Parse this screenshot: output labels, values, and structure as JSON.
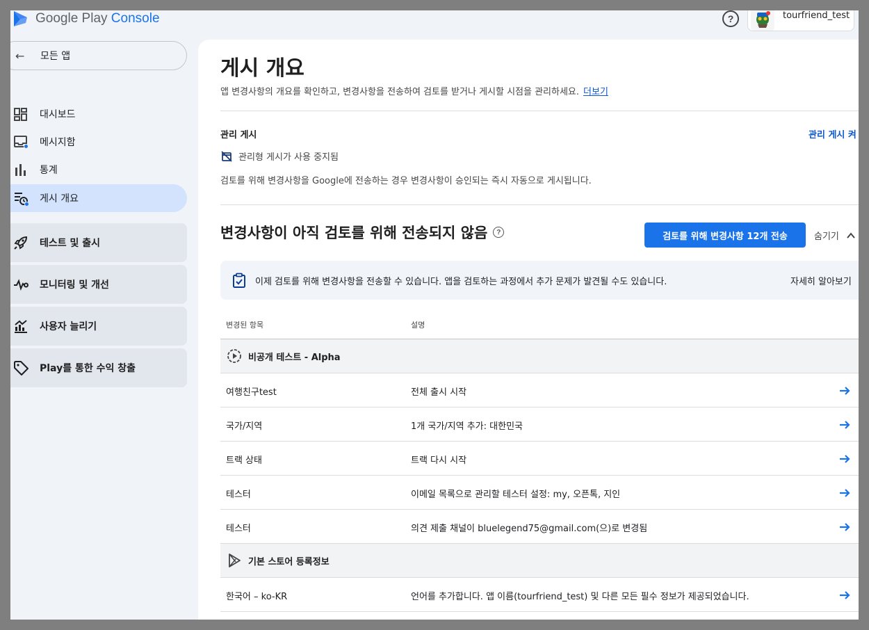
{
  "header": {
    "logo_text_main": "Google Play",
    "logo_text_accent": "Console",
    "account_name": "tourfriend_test"
  },
  "sidebar": {
    "back_label": "모든 앱",
    "items": [
      {
        "label": "대시보드",
        "icon": "dashboard-icon"
      },
      {
        "label": "메시지함",
        "icon": "inbox-icon"
      },
      {
        "label": "통계",
        "icon": "bar-chart-icon"
      },
      {
        "label": "게시 개요",
        "icon": "publishing-overview-icon"
      }
    ],
    "sections": [
      {
        "label": "테스트 및 출시",
        "icon": "rocket-icon"
      },
      {
        "label": "모니터링 및 개선",
        "icon": "vitals-icon"
      },
      {
        "label": "사용자 늘리기",
        "icon": "growth-icon"
      },
      {
        "label": "Play를 통한 수익 창출",
        "icon": "tag-icon"
      }
    ]
  },
  "page": {
    "title": "게시 개요",
    "description": "앱 변경사항의 개요를 확인하고, 변경사항을 전송하여 검토를 받거나 게시할 시점을 관리하세요.",
    "learn_more": "더보기"
  },
  "managed_publishing": {
    "title": "관리 게시",
    "toggle_link": "관리 게시 켜",
    "status": "관리형 게시가 사용 중지됨",
    "description": "검토를 위해 변경사항을 Google에 전송하는 경우 변경사항이 승인되는 즉시 자동으로 게시됩니다."
  },
  "changes": {
    "title": "변경사항이 아직 검토를 위해 전송되지 않음",
    "send_button": "검토를 위해 변경사항 12개 전송",
    "hide_label": "숨기기",
    "notice": "이제 검토를 위해 변경사항을 전송할 수 있습니다. 앱을 검토하는 과정에서 추가 문제가 발견될 수도 있습니다.",
    "notice_link": "자세히 알아보기",
    "table": {
      "col_item": "변경된 항목",
      "col_desc": "설명",
      "groups": [
        {
          "label": "비공개 테스트 - Alpha",
          "icon": "closed-testing-icon",
          "rows": [
            {
              "item": "여행친구test",
              "desc": "전체 출시 시작"
            },
            {
              "item": "국가/지역",
              "desc": "1개 국가/지역 추가: 대한민국"
            },
            {
              "item": "트랙 상태",
              "desc": "트랙 다시 시작"
            },
            {
              "item": "테스터",
              "desc": "이메일 목록으로 관리할 테스터 설정: my, 오픈톡, 지인"
            },
            {
              "item": "테스터",
              "desc": "의견 제출 채널이 bluelegend75@gmail.com(으)로 변경됨"
            }
          ]
        },
        {
          "label": "기본 스토어 등록정보",
          "icon": "play-store-icon",
          "rows": [
            {
              "item": "한국어 – ko-KR",
              "desc": "언어를 추가합니다. 앱 이름(tourfriend_test) 및 다른 모든 필수 정보가 제공되었습니다."
            }
          ]
        }
      ]
    }
  },
  "colors": {
    "accent": "#1a73e8",
    "active_nav": "#d3e3fd",
    "link": "#0b57d0"
  }
}
